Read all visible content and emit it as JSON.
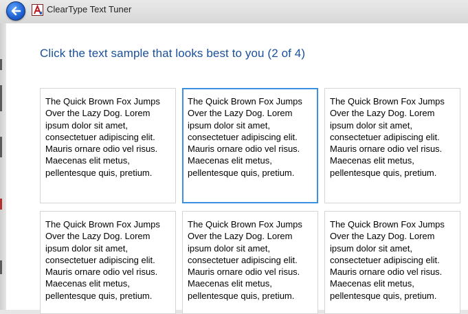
{
  "window": {
    "title": "ClearType Text Tuner"
  },
  "instructions": "Click the text sample that looks best to you (2 of 4)",
  "samples": [
    {
      "lines": [
        "The Quick Brown Fox Jumps",
        "Over the Lazy Dog. Lorem",
        "ipsum dolor sit amet,",
        "consectetuer adipiscing elit.",
        "Mauris ornare odio vel risus.",
        "Maecenas elit metus,",
        "pellentesque quis, pretium."
      ],
      "selected": false
    },
    {
      "lines": [
        "The Quick Brown Fox Jumps",
        "Over the Lazy Dog. Lorem",
        "ipsum dolor sit amet,",
        "consectetuer adipiscing elit.",
        "Mauris ornare odio vel risus.",
        "Maecenas elit metus,",
        "pellentesque quis, pretium."
      ],
      "selected": true
    },
    {
      "lines": [
        "The Quick Brown Fox Jumps",
        "Over the Lazy Dog. Lorem",
        "ipsum dolor sit amet,",
        "consectetuer adipiscing elit.",
        "Mauris ornare odio vel risus.",
        "Maecenas elit metus,",
        "pellentesque quis, pretium."
      ],
      "selected": false
    },
    {
      "lines": [
        "The Quick Brown Fox Jumps",
        "Over the Lazy Dog. Lorem",
        "ipsum dolor sit amet,",
        "consectetuer adipiscing elit.",
        "Mauris ornare odio vel risus.",
        "Maecenas elit metus,",
        "pellentesque quis, pretium."
      ],
      "selected": false
    },
    {
      "lines": [
        "The Quick Brown Fox Jumps",
        "Over the Lazy Dog. Lorem",
        "ipsum dolor sit amet,",
        "consectetuer adipiscing elit.",
        "Mauris ornare odio vel risus.",
        "Maecenas elit metus,",
        "pellentesque quis, pretium."
      ],
      "selected": false
    },
    {
      "lines": [
        "The Quick Brown Fox Jumps",
        "Over the Lazy Dog. Lorem",
        "ipsum dolor sit amet,",
        "consectetuer adipiscing elit.",
        "Mauris ornare odio vel risus.",
        "Maecenas elit metus,",
        "pellentesque quis, pretium."
      ],
      "selected": false
    }
  ],
  "icons": {
    "back": "back-arrow-icon",
    "app": "cleartype-app-icon"
  },
  "colors": {
    "heading": "#1a4f9c",
    "selection_border": "#3c8ee0"
  }
}
